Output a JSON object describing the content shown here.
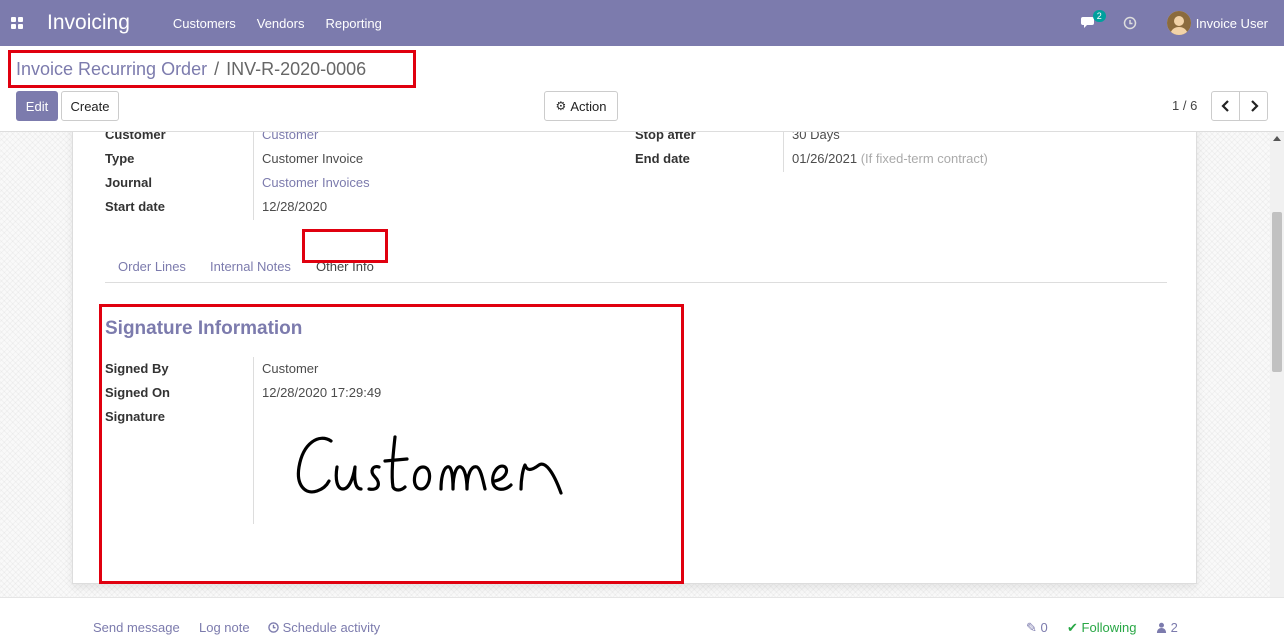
{
  "app": {
    "title": "Invoicing"
  },
  "nav": {
    "menu": [
      "Customers",
      "Vendors",
      "Reporting"
    ],
    "messages_count": "2",
    "user_name": "Invoice User"
  },
  "breadcrumb": {
    "parent": "Invoice Recurring Order",
    "separator": "/",
    "current": "INV-R-2020-0006"
  },
  "toolbar": {
    "edit_label": "Edit",
    "create_label": "Create",
    "action_label": "Action"
  },
  "pager": {
    "value": "1 / 6"
  },
  "form": {
    "customer": {
      "label": "Customer",
      "value": "Customer"
    },
    "type": {
      "label": "Type",
      "value": "Customer Invoice"
    },
    "journal": {
      "label": "Journal",
      "value": "Customer Invoices"
    },
    "start_date": {
      "label": "Start date",
      "value": "12/28/2020"
    },
    "stop_after": {
      "label": "Stop after",
      "value": "30 Days"
    },
    "end_date": {
      "label": "End date",
      "value": "01/26/2021",
      "hint": "(If fixed-term contract)"
    }
  },
  "tabs": [
    {
      "label": "Order Lines",
      "active": false
    },
    {
      "label": "Internal Notes",
      "active": false
    },
    {
      "label": "Other Info",
      "active": true
    }
  ],
  "signature_section": {
    "title": "Signature Information",
    "signed_by": {
      "label": "Signed By",
      "value": "Customer"
    },
    "signed_on": {
      "label": "Signed On",
      "value": "12/28/2020 17:29:49"
    },
    "signature": {
      "label": "Signature",
      "text": "Customer"
    }
  },
  "chatter": {
    "send_message": "Send message",
    "log_note": "Log note",
    "schedule_activity": "Schedule activity",
    "attachments_count": "0",
    "following": "Following",
    "followers_count": "2"
  },
  "colors": {
    "brand": "#7c7bad",
    "highlight": "#e0000f",
    "following": "#28a745"
  }
}
